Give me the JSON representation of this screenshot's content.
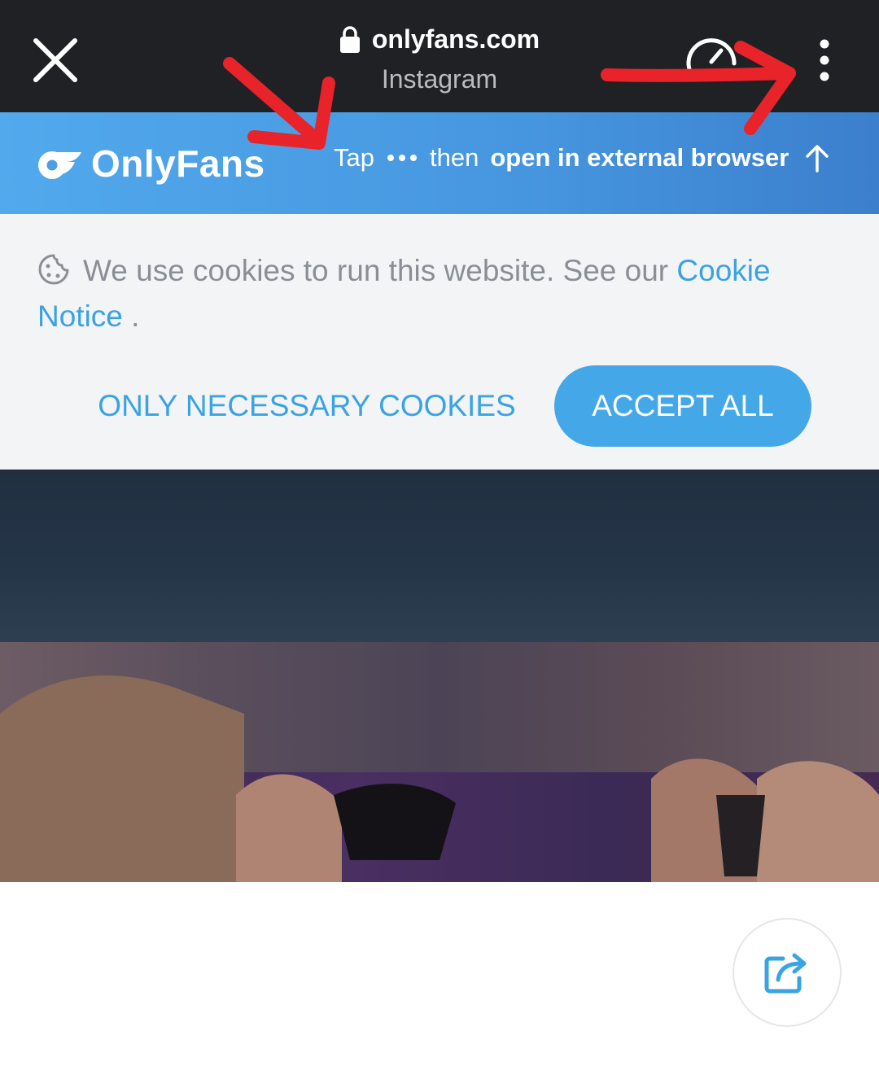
{
  "browser": {
    "domain": "onlyfans.com",
    "source_app": "Instagram"
  },
  "banner": {
    "brand": "OnlyFans",
    "tap_label": "Tap",
    "then_label": "then",
    "instruction_bold": "open in external browser"
  },
  "cookie_notice": {
    "text": "We use cookies to run this website. See our",
    "link_text": "Cookie Notice",
    "link_suffix": " .",
    "only_necessary_label": "ONLY NECESSARY COOKIES",
    "accept_all_label": "ACCEPT ALL"
  },
  "colors": {
    "topbar": "#202125",
    "banner": "#4696df",
    "accent": "#3aa3e3",
    "accept_button": "#44a8e8",
    "cookie_panel": "#f3f4f6",
    "annotation": "#e8232a"
  },
  "icons": {
    "close": "close-icon",
    "lock": "lock-icon",
    "speed": "speedometer-icon",
    "menu": "more-vert-icon",
    "brand": "onlyfans-logo-icon",
    "dots": "more-horiz-icon",
    "arrow": "arrow-up-icon",
    "cookie": "cookie-icon",
    "share": "share-icon"
  }
}
